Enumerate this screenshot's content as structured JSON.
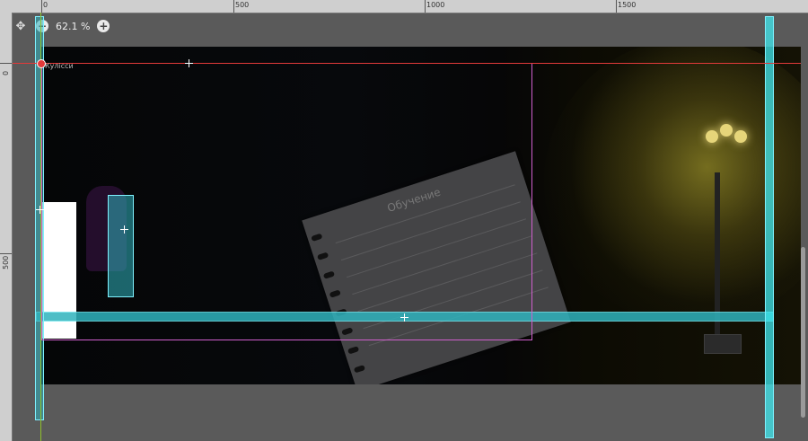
{
  "ruler": {
    "top_labels": [
      "0",
      "500",
      "1000",
      "1500"
    ],
    "left_labels": [
      "0",
      "500"
    ]
  },
  "toolbar": {
    "zoom_value": "62.1 %",
    "icons": [
      "move-icon",
      "zoom-out-icon",
      "zoom-in-icon"
    ]
  },
  "scene": {
    "origin_label": "Кулісси",
    "notebook_title": "Обучение"
  },
  "colors": {
    "collision_cyan": "#2fb3bd",
    "camera_frame_pink": "#d05fcd",
    "axis_red": "#e33a3a",
    "axis_green": "#8fc02a",
    "lamp_glow": "#9a8f2a"
  }
}
